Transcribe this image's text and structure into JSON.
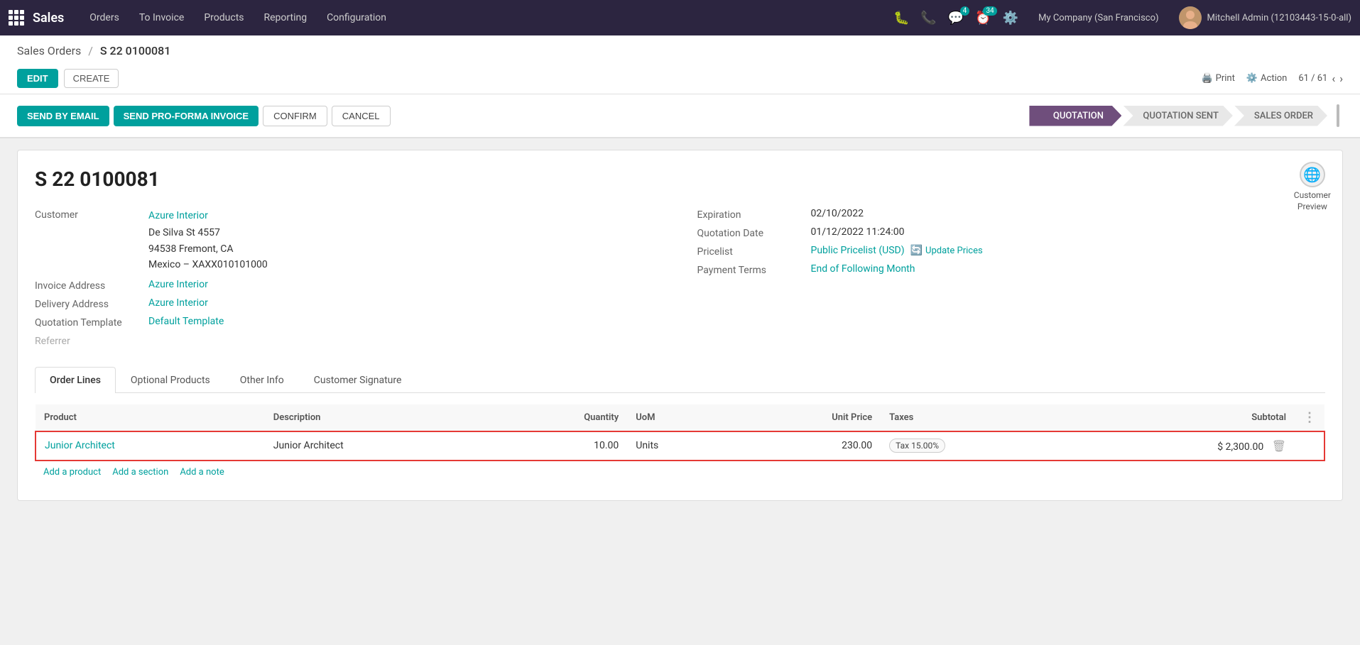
{
  "topnav": {
    "app_name": "Sales",
    "nav_items": [
      "Orders",
      "To Invoice",
      "Products",
      "Reporting",
      "Configuration"
    ],
    "notification_count": "4",
    "activity_count": "34",
    "company": "My Company (San Francisco)",
    "user": "Mitchell Admin (12103443-15-0-all)"
  },
  "breadcrumb": {
    "parent": "Sales Orders",
    "current": "S 22 0100081"
  },
  "action_bar": {
    "edit_label": "EDIT",
    "create_label": "CREATE",
    "print_label": "Print",
    "action_label": "Action",
    "pagination": "61 / 61"
  },
  "status_bar": {
    "send_email_label": "SEND BY EMAIL",
    "pro_forma_label": "SEND PRO-FORMA INVOICE",
    "confirm_label": "CONFIRM",
    "cancel_label": "CANCEL",
    "steps": [
      "QUOTATION",
      "QUOTATION SENT",
      "SALES ORDER"
    ],
    "active_step": "QUOTATION"
  },
  "document": {
    "number": "S 22 0100081",
    "customer_preview_label": "Customer\nPreview",
    "fields": {
      "customer_label": "Customer",
      "customer_name": "Azure Interior",
      "customer_address1": "De Silva St 4557",
      "customer_address2": "94538 Fremont, CA",
      "customer_address3": "Mexico – XAXX010101000",
      "invoice_address_label": "Invoice Address",
      "invoice_address_value": "Azure Interior",
      "delivery_address_label": "Delivery Address",
      "delivery_address_value": "Azure Interior",
      "quotation_template_label": "Quotation Template",
      "quotation_template_value": "Default Template",
      "referrer_label": "Referrer",
      "expiration_label": "Expiration",
      "expiration_value": "02/10/2022",
      "quotation_date_label": "Quotation Date",
      "quotation_date_value": "01/12/2022 11:24:00",
      "pricelist_label": "Pricelist",
      "pricelist_value": "Public Pricelist (USD)",
      "update_prices_label": "Update Prices",
      "payment_terms_label": "Payment Terms",
      "payment_terms_value": "End of Following Month"
    }
  },
  "tabs": {
    "items": [
      "Order Lines",
      "Optional Products",
      "Other Info",
      "Customer Signature"
    ],
    "active": "Order Lines"
  },
  "table": {
    "columns": [
      "Product",
      "Description",
      "Quantity",
      "UoM",
      "Unit Price",
      "Taxes",
      "Subtotal",
      ""
    ],
    "rows": [
      {
        "product": "Junior Architect",
        "description": "Junior Architect",
        "quantity": "10.00",
        "uom": "Units",
        "unit_price": "230.00",
        "taxes": "Tax 15.00%",
        "subtotal": "$ 2,300.00"
      }
    ],
    "add_product_label": "Add a product",
    "add_section_label": "Add a section",
    "add_note_label": "Add a note"
  }
}
